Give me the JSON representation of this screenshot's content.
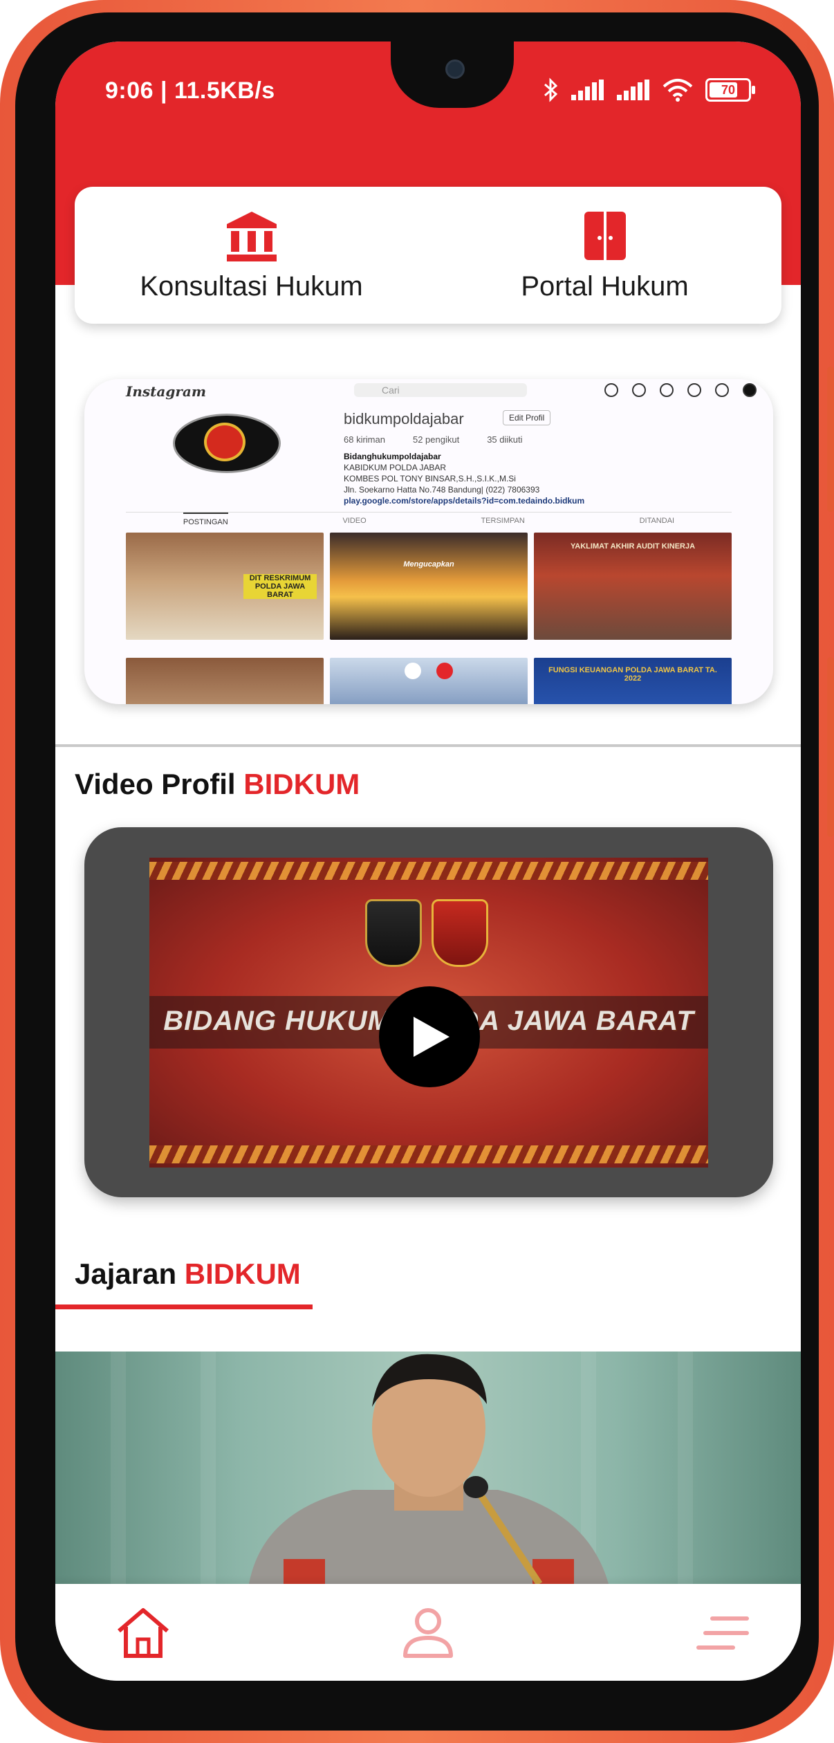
{
  "status_bar": {
    "time_speed": "9:06 | 11.5KB/s",
    "battery": "70"
  },
  "quick_actions": [
    {
      "label": "Konsultasi Hukum",
      "icon": "courthouse-icon"
    },
    {
      "label": "Portal Hukum",
      "icon": "door-icon"
    }
  ],
  "banner": {
    "brand": "Instagram",
    "search_placeholder": "Cari",
    "username": "bidkumpoldajabar",
    "edit_label": "Edit Profil",
    "stats": [
      "68 kiriman",
      "52 pengikut",
      "35 diikuti"
    ],
    "bio_name": "Bidanghukumpoldajabar",
    "bio_lines": [
      "KABIDKUM POLDA JABAR",
      "KOMBES POL TONY BINSAR,S.H.,S.I.K.,M.Si",
      "Jln. Soekarno Hatta No.748 Bandung| (022) 7806393"
    ],
    "bio_link": "play.google.com/store/apps/details?id=com.tedaindo.bidkum",
    "tabs": [
      "POSTINGAN",
      "VIDEO",
      "TERSIMPAN",
      "DITANDAI"
    ],
    "posts": [
      "DIT RESKRIMUM POLDA JAWA BARAT",
      "Mengucapkan",
      "YAKLIMAT AKHIR AUDIT KINERJA",
      "",
      "",
      "FUNGSI KEUANGAN POLDA JAWA BARAT TA. 2022"
    ],
    "slides_total": 2,
    "active_slide": 2
  },
  "video_section": {
    "title_prefix": "Video Profil",
    "title_accent": "BIDKUM",
    "video_text": "BIDANG HUKUM POLDA JAWA BARAT",
    "badge_label": "JAWA BARAT"
  },
  "leader_section": {
    "title_prefix": "Jajaran",
    "title_accent": "BIDKUM"
  },
  "bottom_nav": [
    {
      "name": "home",
      "icon": "home-icon",
      "active": true
    },
    {
      "name": "profile",
      "icon": "user-icon",
      "active": false
    },
    {
      "name": "menu",
      "icon": "menu-icon",
      "active": false
    }
  ],
  "colors": {
    "brand_red": "#e3262a",
    "phone_orange": "#f37a4f",
    "inactive_icon": "#f2a3a5"
  }
}
